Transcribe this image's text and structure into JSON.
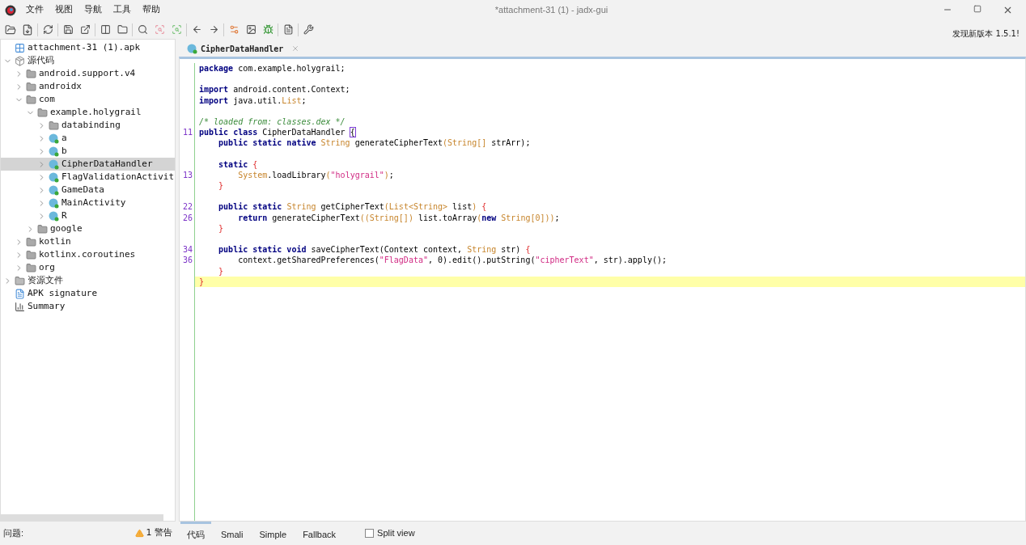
{
  "window": {
    "title": "*attachment-31 (1) - jadx-gui"
  },
  "menu": [
    "文件",
    "视图",
    "导航",
    "工具",
    "帮助"
  ],
  "update_notice": "发现新版本 1.5.1!",
  "tree": [
    {
      "label": "attachment-31 (1).apk",
      "kind": "apk"
    },
    {
      "label": "源代码",
      "kind": "sources",
      "expanded": true,
      "selected": false,
      "children": [
        {
          "label": "android.support.v4",
          "kind": "folder",
          "expanded": false,
          "selected": false
        },
        {
          "label": "androidx",
          "kind": "folder",
          "expanded": false,
          "selected": false
        },
        {
          "label": "com",
          "kind": "folder",
          "expanded": true,
          "selected": false,
          "children": [
            {
              "label": "example.holygrail",
              "kind": "folder",
              "expanded": true,
              "selected": false,
              "children": [
                {
                  "label": "databinding",
                  "kind": "folder",
                  "expanded": false,
                  "selected": false
                },
                {
                  "label": "a",
                  "kind": "class",
                  "expanded": false,
                  "selected": false
                },
                {
                  "label": "b",
                  "kind": "class",
                  "expanded": false,
                  "selected": false
                },
                {
                  "label": "CipherDataHandler",
                  "kind": "class",
                  "expanded": false,
                  "selected": true
                },
                {
                  "label": "FlagValidationActivit",
                  "kind": "class",
                  "expanded": false,
                  "selected": false
                },
                {
                  "label": "GameData",
                  "kind": "class",
                  "expanded": false,
                  "selected": false
                },
                {
                  "label": "MainActivity",
                  "kind": "class",
                  "expanded": false,
                  "selected": false
                },
                {
                  "label": "R",
                  "kind": "class",
                  "expanded": false,
                  "selected": false
                }
              ]
            },
            {
              "label": "google",
              "kind": "folder",
              "expanded": false,
              "selected": false
            }
          ]
        },
        {
          "label": "kotlin",
          "kind": "folder",
          "expanded": false,
          "selected": false
        },
        {
          "label": "kotlinx.coroutines",
          "kind": "folder",
          "expanded": false,
          "selected": false
        },
        {
          "label": "org",
          "kind": "folder",
          "expanded": false,
          "selected": false
        }
      ]
    },
    {
      "label": "资源文件",
      "kind": "resources",
      "expanded": false,
      "selected": false
    },
    {
      "label": "APK signature",
      "kind": "signature",
      "selected": false
    },
    {
      "label": "Summary",
      "kind": "summary",
      "selected": false
    }
  ],
  "editor_tabs": [
    {
      "label": "CipherDataHandler",
      "selected": true
    }
  ],
  "code": [
    {
      "highlighted": false,
      "tokens": [
        {
          "kind": "kw",
          "text": "package"
        },
        {
          "kind": "plain",
          "text": " com.example.holygrail;"
        }
      ]
    },
    {
      "highlighted": false
    },
    {
      "highlighted": false,
      "tokens": [
        {
          "kind": "kw",
          "text": "import"
        },
        {
          "kind": "plain",
          "text": " android.content.Context;"
        }
      ]
    },
    {
      "highlighted": false,
      "tokens": [
        {
          "kind": "kw",
          "text": "import"
        },
        {
          "kind": "plain",
          "text": " java.util."
        },
        {
          "kind": "type",
          "text": "List"
        },
        {
          "kind": "plain",
          "text": ";"
        }
      ]
    },
    {
      "highlighted": false
    },
    {
      "highlighted": false,
      "tokens": [
        {
          "kind": "comment",
          "text": "/* loaded from: classes.dex */"
        }
      ]
    },
    {
      "number": "11",
      "highlighted": false,
      "tokens": [
        {
          "kind": "kw",
          "text": "public class"
        },
        {
          "kind": "plain",
          "text": " CipherDataHandler "
        },
        {
          "kind": "cursor",
          "text": "{"
        }
      ]
    },
    {
      "highlighted": false,
      "tokens": [
        {
          "kind": "kw",
          "text": "    public static native "
        },
        {
          "kind": "type",
          "text": "String"
        },
        {
          "kind": "plain",
          "text": " generateCipherText"
        },
        {
          "kind": "type",
          "text": "(String[]"
        },
        {
          "kind": "plain",
          "text": " strArr);"
        }
      ]
    },
    {
      "highlighted": false
    },
    {
      "highlighted": false,
      "tokens": [
        {
          "kind": "kw",
          "text": "    static "
        },
        {
          "kind": "brace",
          "text": "{"
        }
      ]
    },
    {
      "number": "13",
      "highlighted": false,
      "tokens": [
        {
          "kind": "type",
          "text": "        System"
        },
        {
          "kind": "plain",
          "text": ".loadLibrary"
        },
        {
          "kind": "type",
          "text": "("
        },
        {
          "kind": "str",
          "text": "\"holygrail\""
        },
        {
          "kind": "type",
          "text": ")"
        },
        {
          "kind": "plain",
          "text": ";"
        }
      ]
    },
    {
      "highlighted": false,
      "tokens": [
        {
          "kind": "brace",
          "text": "    }"
        }
      ]
    },
    {
      "highlighted": false
    },
    {
      "number": "22",
      "highlighted": false,
      "tokens": [
        {
          "kind": "kw",
          "text": "    public static "
        },
        {
          "kind": "type",
          "text": "String"
        },
        {
          "kind": "plain",
          "text": " getCipherText"
        },
        {
          "kind": "type",
          "text": "(List<String>"
        },
        {
          "kind": "plain",
          "text": " list"
        },
        {
          "kind": "type",
          "text": ")"
        },
        {
          "kind": "brace",
          "text": " {"
        }
      ]
    },
    {
      "number": "26",
      "highlighted": false,
      "tokens": [
        {
          "kind": "kw",
          "text": "        return"
        },
        {
          "kind": "plain",
          "text": " generateCipherText"
        },
        {
          "kind": "type",
          "text": "((String[])"
        },
        {
          "kind": "plain",
          "text": " list.toArray"
        },
        {
          "kind": "type",
          "text": "("
        },
        {
          "kind": "kw",
          "text": "new"
        },
        {
          "kind": "type",
          "text": " String[0]))"
        },
        {
          "kind": "plain",
          "text": ";"
        }
      ]
    },
    {
      "highlighted": false,
      "tokens": [
        {
          "kind": "brace",
          "text": "    }"
        }
      ]
    },
    {
      "highlighted": false
    },
    {
      "number": "34",
      "highlighted": false,
      "tokens": [
        {
          "kind": "kw",
          "text": "    public static void"
        },
        {
          "kind": "plain",
          "text": " saveCipherText(Context context, "
        },
        {
          "kind": "type",
          "text": "String"
        },
        {
          "kind": "plain",
          "text": " str) "
        },
        {
          "kind": "brace",
          "text": "{"
        }
      ]
    },
    {
      "number": "36",
      "highlighted": false,
      "tokens": [
        {
          "kind": "plain",
          "text": "        context.getSharedPreferences("
        },
        {
          "kind": "str",
          "text": "\"FlagData\""
        },
        {
          "kind": "plain",
          "text": ", 0).edit().putString("
        },
        {
          "kind": "str",
          "text": "\"cipherText\""
        },
        {
          "kind": "plain",
          "text": ", str).apply();"
        }
      ]
    },
    {
      "highlighted": false,
      "tokens": [
        {
          "kind": "brace",
          "text": "    }"
        }
      ]
    },
    {
      "highlighted": true,
      "tokens": [
        {
          "kind": "brace",
          "text": "}"
        }
      ]
    }
  ],
  "status": {
    "label": "问题:",
    "warnings": "1 警告"
  },
  "view_tabs": [
    {
      "label": "代码",
      "selected": true
    },
    {
      "label": "Smali",
      "selected": false
    },
    {
      "label": "Simple",
      "selected": false
    },
    {
      "label": "Fallback",
      "selected": false
    }
  ],
  "split_view": {
    "label": "Split view",
    "checked": false
  }
}
